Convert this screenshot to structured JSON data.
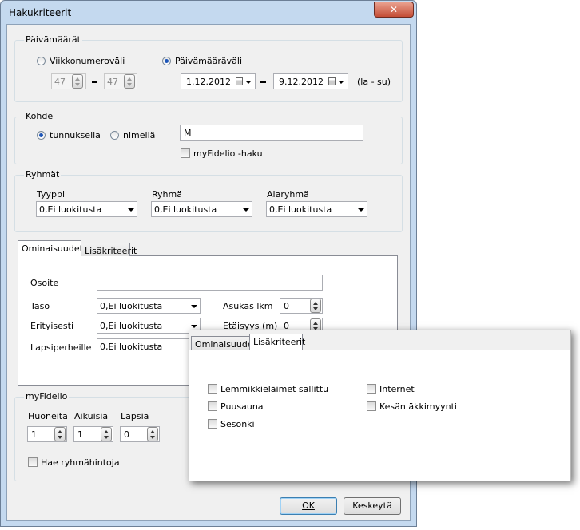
{
  "dialog": {
    "title": "Hakukriteerit",
    "close_glyph": "✕"
  },
  "dates": {
    "group_label": "Päivämäärät",
    "week_radio_label": "Viikkonumeroväli",
    "date_radio_label": "Päivämääräväli",
    "week_from": "47",
    "week_to": "47",
    "date_from": "1.12.2012",
    "date_to": "9.12.2012",
    "range_note": "(la - su)",
    "selected": "date-range"
  },
  "target": {
    "group_label": "Kohde",
    "by_id_label": "tunnuksella",
    "by_name_label": "nimellä",
    "query_value": "M",
    "myfidelio_search_label": "myFidelio -haku",
    "selected": "by-id"
  },
  "groups": {
    "group_label": "Ryhmät",
    "type_label": "Tyyppi",
    "group_col_label": "Ryhmä",
    "subgroup_label": "Alaryhmä",
    "type_value": "0,Ei luokitusta",
    "group_value": "0,Ei luokitusta",
    "subgroup_value": "0,Ei luokitusta"
  },
  "tabs": {
    "properties_label": "Ominaisuudet",
    "extra_criteria_label": "Lisäkriteerit",
    "active": "properties"
  },
  "properties": {
    "address_label": "Osoite",
    "address_value": "",
    "level_label": "Taso",
    "level_value": "0,Ei luokitusta",
    "separately_label": "Erityisesti",
    "separately_value": "0,Ei luokitusta",
    "children_label": "Lapsiperheille",
    "children_value": "0,Ei luokitusta",
    "residents_label": "Asukas lkm",
    "residents_value": "0",
    "distance_label": "Etäisyys (m)",
    "distance_value": "0"
  },
  "myfidelio": {
    "group_label": "myFidelio",
    "rooms_label": "Huoneita",
    "adults_label": "Aikuisia",
    "children_label": "Lapsia",
    "rooms_value": "1",
    "adults_value": "1",
    "children_value": "0",
    "group_prices_label": "Hae ryhmähintoja"
  },
  "buttons": {
    "ok_label": "OK",
    "cancel_label": "Keskeytä"
  },
  "popup": {
    "tab_properties": "Ominaisuudet",
    "tab_extra": "Lisäkriteerit",
    "active": "extra",
    "pets_label": "Lemmikkieläimet sallittu",
    "wood_sauna_label": "Puusauna",
    "season_label": "Sesonki",
    "internet_label": "Internet",
    "summer_sale_label": "Kesän äkkimyynti"
  },
  "colors": {
    "window_frame": "#c4d9ef",
    "dialog_bg": "#f0f0f0",
    "close_button": "#c44d36",
    "default_button_border": "#3c7fb1",
    "radio_selected": "#1e56b8"
  }
}
